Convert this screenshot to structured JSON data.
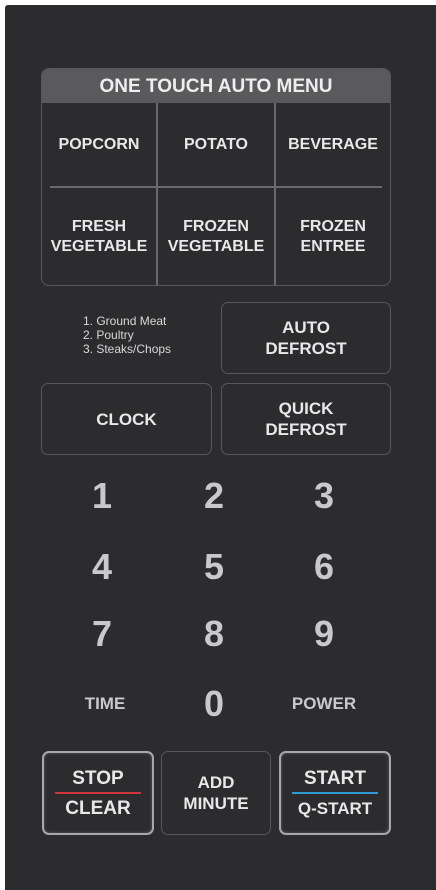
{
  "menu": {
    "title": "ONE TOUCH AUTO MENU",
    "row1": [
      "POPCORN",
      "POTATO",
      "BEVERAGE"
    ],
    "row2": [
      [
        "FRESH",
        "VEGETABLE"
      ],
      [
        "FROZEN",
        "VEGETABLE"
      ],
      [
        "FROZEN",
        "ENTREE"
      ]
    ]
  },
  "defrost_notes": [
    "1. Ground Meat",
    "2. Poultry",
    "3. Steaks/Chops"
  ],
  "auto_defrost": [
    "AUTO",
    "DEFROST"
  ],
  "clock": "CLOCK",
  "quick_defrost": [
    "QUICK",
    "DEFROST"
  ],
  "keypad": [
    "1",
    "2",
    "3",
    "4",
    "5",
    "6",
    "7",
    "8",
    "9"
  ],
  "time": "TIME",
  "zero": "0",
  "power": "POWER",
  "stop": {
    "top": "STOP",
    "bottom": "CLEAR",
    "bar_color": "#d0343c"
  },
  "add_minute": [
    "ADD",
    "MINUTE"
  ],
  "start": {
    "top": "START",
    "bottom": "Q-START",
    "bar_color": "#2f9bd6"
  },
  "colors": {
    "panel": "#2c2c2e",
    "header": "#5a5a5c",
    "text": "#e8e8e8"
  }
}
